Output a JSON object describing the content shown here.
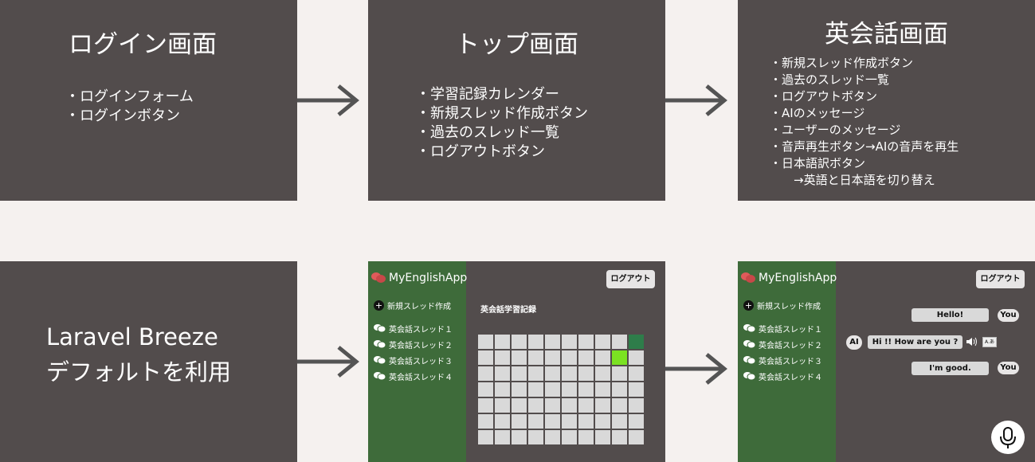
{
  "login_screen": {
    "title": "ログイン画面",
    "items": [
      "・ログインフォーム",
      "・ログインボタン"
    ]
  },
  "top_screen": {
    "title": "トップ画面",
    "items": [
      "・学習記録カレンダー",
      "・新規スレッド作成ボタン",
      "・過去のスレッド一覧",
      "・ログアウトボタン"
    ]
  },
  "conversation_screen": {
    "title": "英会話画面",
    "items": [
      "・新規スレッド作成ボタン",
      "・過去のスレッド一覧",
      "・ログアウトボタン",
      "・AIのメッセージ",
      "・ユーザーのメッセージ",
      "・音声再生ボタン→AIの音声を再生",
      "・日本語訳ボタン",
      "　　→英語と日本語を切り替え"
    ]
  },
  "breeze_note": {
    "line1": "Laravel Breeze",
    "line2": "デフォルトを利用"
  },
  "mockup": {
    "app_name": "MyEnglishApp",
    "new_thread": "新規スレッド作成",
    "threads": [
      "英会話スレッド１",
      "英会話スレッド２",
      "英会話スレッド３",
      "英会話スレッド４"
    ],
    "logout": "ログアウト",
    "calendar_title": "英会話学習記録",
    "calendar": {
      "rows": 7,
      "cols": 10,
      "highlights": [
        {
          "row": 0,
          "col": 9,
          "color": "#2e7d4a"
        },
        {
          "row": 1,
          "col": 8,
          "color": "#7be222"
        }
      ]
    },
    "chat": {
      "user_msg1": "Hello!",
      "ai_msg": "Hi !! How are you ?",
      "user_msg2": "I'm good.",
      "you_label": "You",
      "ai_label": "AI",
      "translate_label": "A.あ"
    }
  },
  "colors": {
    "background": "#f5f1ef",
    "panel": "#524c4c",
    "sidebar": "#3e6b3a",
    "arrow": "#545454",
    "logo": "#e05a5a"
  }
}
